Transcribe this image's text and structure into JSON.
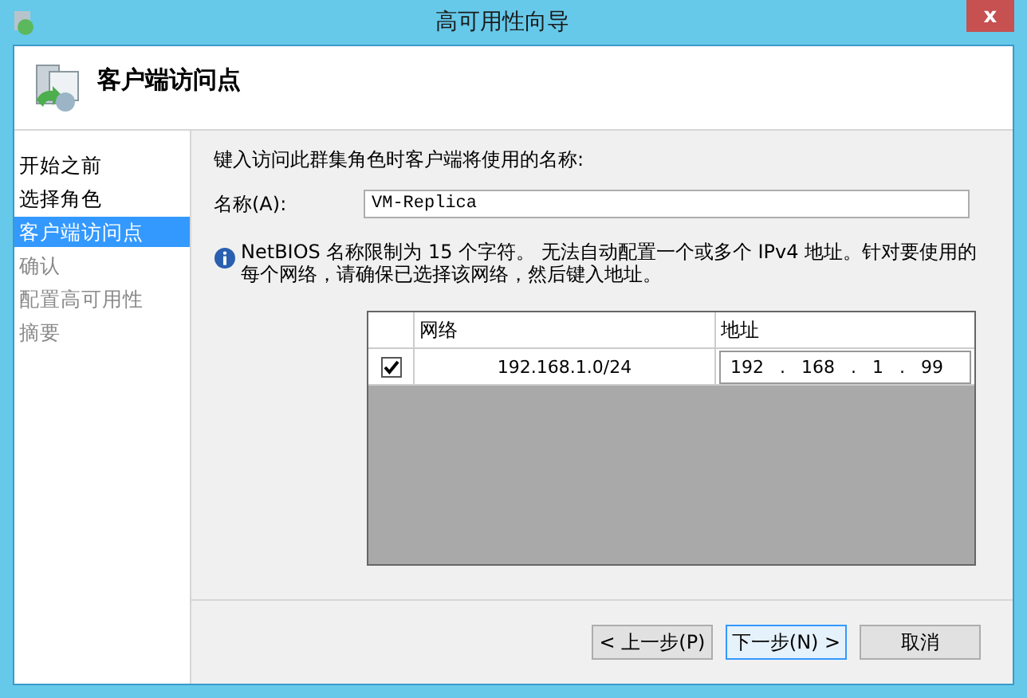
{
  "window": {
    "title": "高可用性向导",
    "close": "x"
  },
  "header": {
    "title": "客户端访问点"
  },
  "sidebar": {
    "items": [
      {
        "label": "开始之前",
        "selected": false,
        "disabled": false
      },
      {
        "label": "选择角色",
        "selected": false,
        "disabled": false
      },
      {
        "label": "客户端访问点",
        "selected": true,
        "disabled": false
      },
      {
        "label": "确认",
        "selected": false,
        "disabled": true
      },
      {
        "label": "配置高可用性",
        "selected": false,
        "disabled": true
      },
      {
        "label": "摘要",
        "selected": false,
        "disabled": true
      }
    ]
  },
  "content": {
    "instruction": "键入访问此群集角色时客户端将使用的名称:",
    "name_label": "名称(A):",
    "name_value": "VM-Replica",
    "info": "NetBIOS 名称限制为 15 个字符。 无法自动配置一个或多个 IPv4 地址。针对要使用的每个网络，请确保已选择该网络，然后键入地址。"
  },
  "table": {
    "columns": [
      "网络",
      "地址"
    ],
    "rows": [
      {
        "checked": true,
        "network": "192.168.1.0/24",
        "address": {
          "octets": [
            "192",
            "168",
            "1",
            "99"
          ],
          "separator": "."
        }
      }
    ]
  },
  "buttons": [
    {
      "label": "< 上一步(P)",
      "focused": false
    },
    {
      "label": "下一步(N) >",
      "focused": true
    },
    {
      "label": "取消",
      "focused": false
    }
  ]
}
